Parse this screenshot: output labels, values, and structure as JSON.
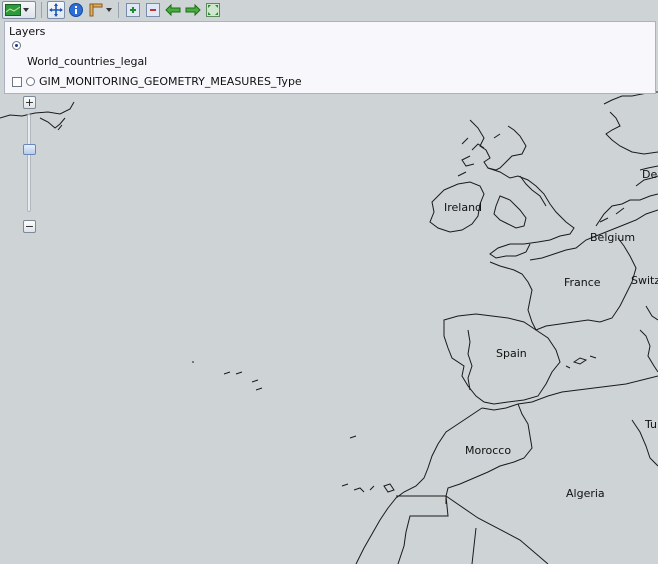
{
  "toolbar": {
    "buttons": [
      {
        "name": "pan-button",
        "icon": "pan-icon"
      },
      {
        "name": "info-button",
        "icon": "info-icon"
      },
      {
        "name": "measure-button",
        "icon": "measure-icon"
      },
      {
        "name": "zoom-in-box-button",
        "icon": "zoom-in-icon"
      },
      {
        "name": "zoom-out-box-button",
        "icon": "zoom-out-icon"
      },
      {
        "name": "history-back-button",
        "icon": "back-arrow-icon"
      },
      {
        "name": "history-forward-button",
        "icon": "forward-arrow-icon"
      },
      {
        "name": "zoom-extent-button",
        "icon": "full-extent-icon"
      }
    ]
  },
  "layers": {
    "title": "Layers",
    "base_layers": [
      {
        "label": "World_countries_legal",
        "selected": true
      }
    ],
    "overlays": [
      {
        "label": "GIM_MONITORING_GEOMETRY_MEASURES_Type",
        "checked": false
      }
    ]
  },
  "zoom": {
    "plus_label": "+",
    "minus_label": "−",
    "level_fraction": 0.35
  },
  "map": {
    "background_color": "#ced3d6",
    "labels": {
      "ireland": "Ireland",
      "belgium": "Belgium",
      "france": "France",
      "switzerland_partial": "Switz",
      "spain": "Spain",
      "morocco": "Morocco",
      "algeria": "Algeria",
      "germany_partial": "De",
      "tunisia_partial": "Tu"
    }
  }
}
